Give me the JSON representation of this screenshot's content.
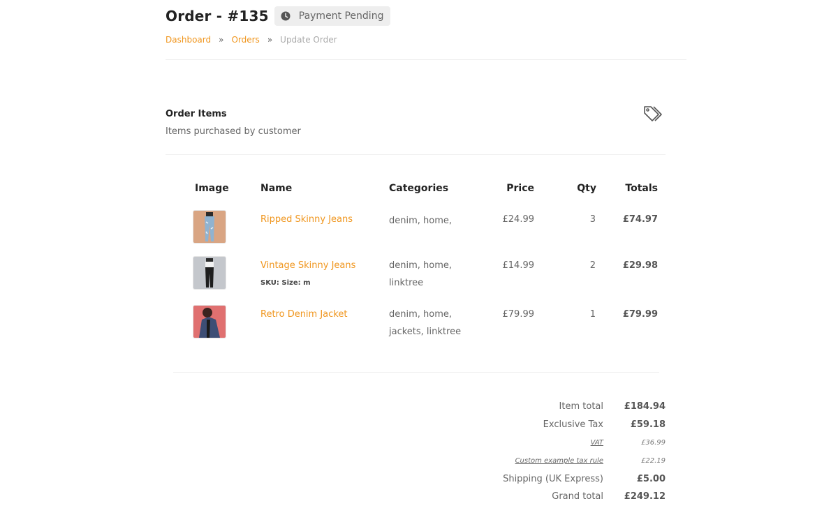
{
  "header": {
    "title": "Order - #135",
    "status": "Payment Pending"
  },
  "breadcrumb": {
    "items": [
      "Dashboard",
      "Orders"
    ],
    "separator": "»",
    "current": "Update Order"
  },
  "section": {
    "title": "Order Items",
    "subtitle": "Items purchased by customer",
    "icon": "tags-icon"
  },
  "table": {
    "columns": {
      "image": "Image",
      "name": "Name",
      "categories": "Categories",
      "price": "Price",
      "qty": "Qty",
      "totals": "Totals"
    },
    "rows": [
      {
        "name": "Ripped Skinny Jeans",
        "sku": "",
        "categories": "denim, home,",
        "price": "£24.99",
        "qty": "3",
        "total": "£74.97",
        "thumb_bg": "#d9a583"
      },
      {
        "name": "Vintage Skinny Jeans",
        "sku": "SKU: Size: m",
        "categories": "denim, home, linktree",
        "price": "£14.99",
        "qty": "2",
        "total": "£29.98",
        "thumb_bg": "#c4c7cc"
      },
      {
        "name": "Retro Denim Jacket",
        "sku": "",
        "categories": "denim, home, jackets, linktree",
        "price": "£79.99",
        "qty": "1",
        "total": "£79.99",
        "thumb_bg": "#e07070"
      }
    ]
  },
  "totals": {
    "item_total_label": "Item total",
    "item_total": "£184.94",
    "exclusive_tax_label": "Exclusive Tax",
    "exclusive_tax": "£59.18",
    "vat_label": "VAT",
    "vat": "£36.99",
    "custom_tax_label": "Custom example tax rule",
    "custom_tax": "£22.19",
    "shipping_label": "Shipping (UK Express)",
    "shipping": "£5.00",
    "grand_total_label": "Grand total",
    "grand_total": "£249.12"
  },
  "colors": {
    "accent": "#f0961e",
    "badge_bg": "#eeeeee"
  }
}
